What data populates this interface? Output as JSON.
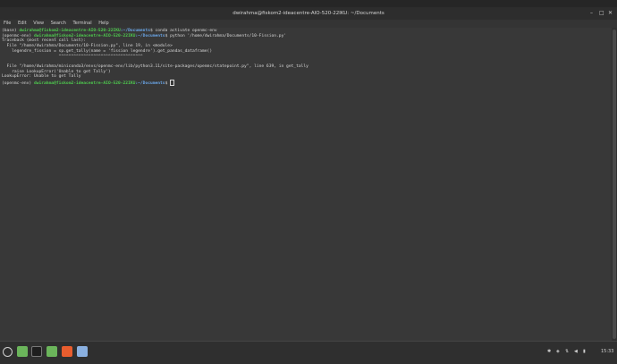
{
  "window": {
    "title": "dwirahma@fiskom2-ideacentre-AIO-520-22IKU: ~/Documents",
    "minimize": "–",
    "maximize": "□",
    "close": "✕"
  },
  "menu": [
    "File",
    "Edit",
    "View",
    "Search",
    "Terminal",
    "Help"
  ],
  "terminal": {
    "line1_env": "(base) ",
    "prompt_user": "dwirahma@fiskom2-ideacentre-AIO-520-22IKU",
    "prompt_path": ":~/Documents",
    "line1_cmd": "$ conda activate openmc-env",
    "line2_env": "(openmc-env) ",
    "line2_cmd": "$ python '/home/dwirahma/Documents/10-Fission.py'",
    "tb1": "Traceback (most recent call last):",
    "tb2": "  File \"/home/dwirahma/Documents/10-Fission.py\", line 19, in <module>",
    "tb3": "    legendre_fission = sp.get_tally(name = 'fission legendre').get_pandas_dataframe()",
    "tb4": "                       ^^^^^^^^^^^^^^^^^^^^^^^^^^^^^^^^^^",
    "tb5": "",
    "tb6": "  File \"/home/dwirahma/miniconda3/envs/openmc-env/lib/python3.11/site-packages/openmc/statepoint.py\", line 639, in get_tally",
    "tb7": "    raise LookupError('Unable to get Tally')",
    "tb8": "LookupError: Unable to get Tally",
    "line_last_env": "(openmc-env) ",
    "line_last_cmd": "$ "
  },
  "taskbar": {
    "clock": "15:33",
    "icons": [
      "mint-menu-icon",
      "files-icon",
      "terminal-icon",
      "folder-icon",
      "app-icon"
    ]
  },
  "colors": {
    "prompt_user": "#4ec94e",
    "prompt_path": "#6aa6e8",
    "background": "#383838"
  }
}
